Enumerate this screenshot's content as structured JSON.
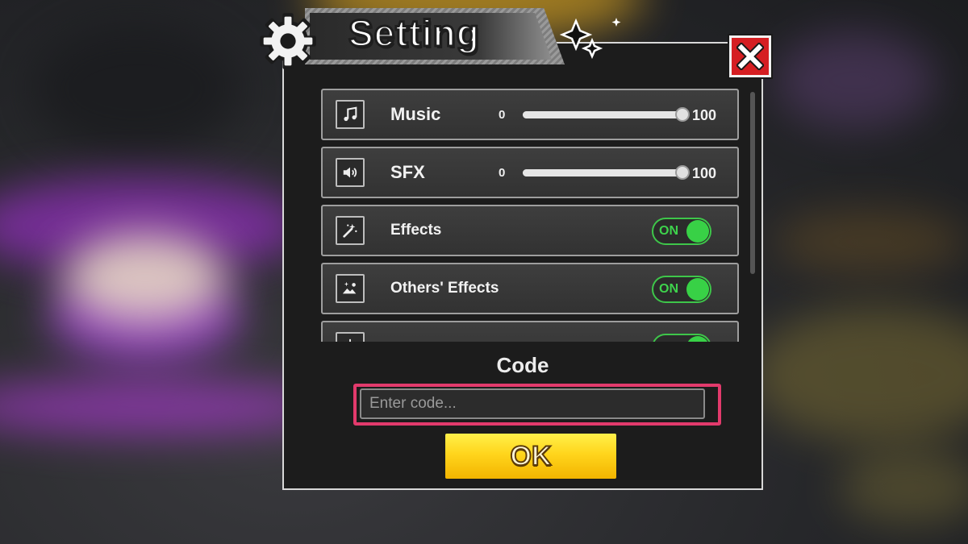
{
  "window": {
    "title": "Setting"
  },
  "settings": [
    {
      "id": "music",
      "label": "Music",
      "kind": "slider",
      "min_label": "0",
      "max_label": "100",
      "value": 100,
      "icon": "music-note-icon"
    },
    {
      "id": "sfx",
      "label": "SFX",
      "kind": "slider",
      "min_label": "0",
      "max_label": "100",
      "value": 100,
      "icon": "speaker-icon"
    },
    {
      "id": "effects",
      "label": "Effects",
      "kind": "toggle",
      "state": "ON",
      "icon": "magic-wand-icon"
    },
    {
      "id": "others-effects",
      "label": "Others' Effects",
      "kind": "toggle",
      "state": "ON",
      "icon": "image-sparkle-icon"
    },
    {
      "id": "partial",
      "label": "",
      "kind": "toggle",
      "state": "ON",
      "icon": "light-icon"
    }
  ],
  "code": {
    "title": "Code",
    "placeholder": "Enter code...",
    "value": "",
    "submit_label": "OK"
  },
  "close_button": {
    "icon": "close-x-icon"
  },
  "colors": {
    "accent_yellow": "#ffd51c",
    "toggle_green": "#38d146",
    "close_red": "#d51e22",
    "highlight_pink": "#e23a6c",
    "panel_bg": "#1c1c1c"
  }
}
